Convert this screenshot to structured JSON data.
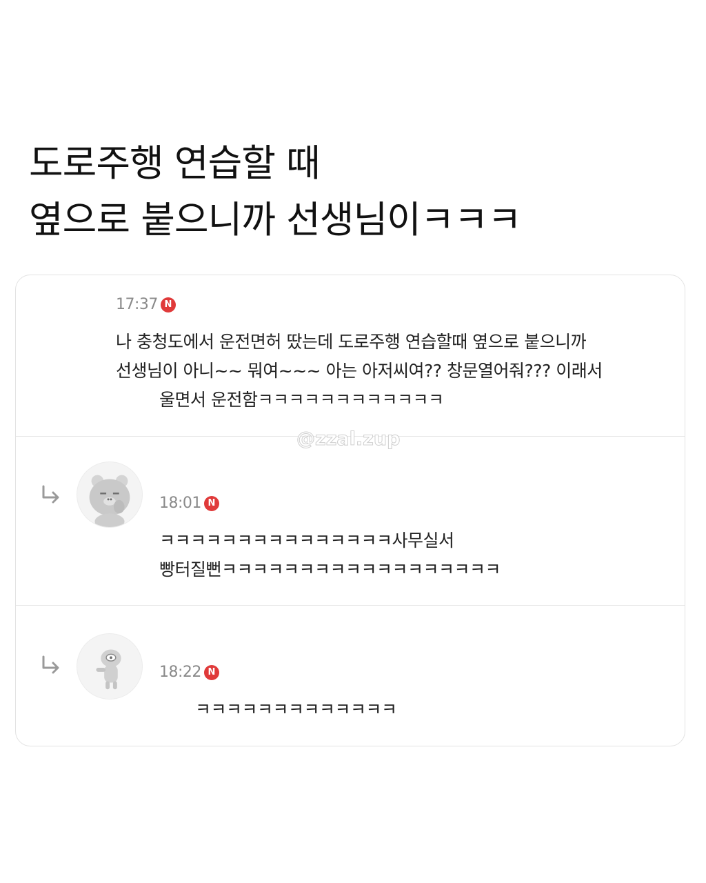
{
  "headline": {
    "line1": "도로주행 연습할 때",
    "line2": "옆으로 붙으니까 선생님이ㅋㅋㅋ"
  },
  "comments": [
    {
      "time": "17:37",
      "badge": "N",
      "lines": [
        "나 충청도에서 운전면허 땄는데 도로주행 연습할때 옆으로 붙으니까",
        "선생님이 아니~~ 뭐여~~~ 아는 아저씨여?? 창문열어줘??? 이래서",
        "울면서 운전함ㅋㅋㅋㅋㅋㅋㅋㅋㅋㅋㅋㅋ"
      ]
    },
    {
      "time": "18:01",
      "badge": "N",
      "avatar_icon": "bear-character-avatar-icon",
      "reply_icon": "reply-arrow-icon",
      "lines": [
        "ㅋㅋㅋㅋㅋㅋㅋㅋㅋㅋㅋㅋㅋㅋㅋ사무실서",
        "빵터질뻔ㅋㅋㅋㅋㅋㅋㅋㅋㅋㅋㅋㅋㅋㅋㅋㅋㅋㅋ"
      ]
    },
    {
      "time": "18:22",
      "badge": "N",
      "avatar_icon": "character-avatar-icon",
      "reply_icon": "reply-arrow-icon",
      "lines": [
        "ㅋㅋㅋㅋㅋㅋㅋㅋㅋㅋㅋㅋㅋ"
      ]
    }
  ],
  "watermark": "@zzal.zup",
  "colors": {
    "badge": "#e03a3a",
    "timestamp": "#8a8a8a",
    "divider": "#e6e6e6"
  }
}
